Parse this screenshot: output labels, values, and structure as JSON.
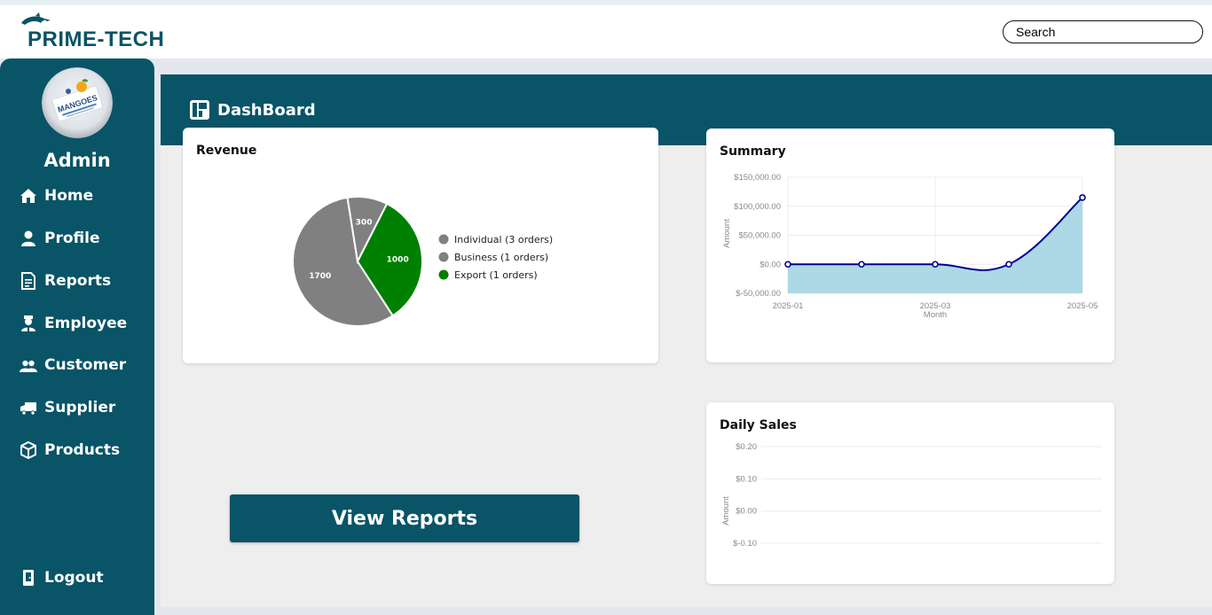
{
  "header": {
    "brand": "PRIME-TECH",
    "search_placeholder": "Search"
  },
  "sidebar": {
    "user_name": "Admin",
    "avatar_logo_text": "MANGOES",
    "items": [
      {
        "label": "Home",
        "icon": "home-icon"
      },
      {
        "label": "Profile",
        "icon": "user-icon"
      },
      {
        "label": "Reports",
        "icon": "report-icon"
      },
      {
        "label": "Employee",
        "icon": "employee-icon"
      },
      {
        "label": "Customer",
        "icon": "customers-icon"
      },
      {
        "label": "Supplier",
        "icon": "truck-icon"
      },
      {
        "label": "Products",
        "icon": "box-icon"
      }
    ],
    "logout": {
      "label": "Logout",
      "icon": "logout-icon"
    }
  },
  "dashboard": {
    "title": "DashBoard",
    "view_reports_label": "View Reports"
  },
  "colors": {
    "primary": "#095467",
    "pie_gray": "#808080",
    "pie_green": "#008000",
    "summary_line": "#00008b",
    "summary_fill": "#add8e6"
  },
  "chart_data": [
    {
      "type": "pie",
      "title": "Revenue",
      "slices": [
        {
          "label": "Individual (3 orders)",
          "value": 1700,
          "color": "#808080"
        },
        {
          "label": "Business (1 orders)",
          "value": 300,
          "color": "#808080"
        },
        {
          "label": "Export (1 orders)",
          "value": 1000,
          "color": "#008000"
        }
      ],
      "legend_position": "right"
    },
    {
      "type": "area",
      "title": "Summary",
      "xlabel": "Month",
      "ylabel": "Amount",
      "x": [
        "2025-01",
        "2025-02",
        "2025-03",
        "2025-04",
        "2025-05"
      ],
      "x_tick_labels": [
        "2025-01",
        "2025-03",
        "2025-05"
      ],
      "values": [
        0,
        0,
        0,
        0,
        115000
      ],
      "ylim": [
        -50000,
        150000
      ],
      "y_ticks": [
        "$150,000.00",
        "$100,000.00",
        "$50,000.00",
        "$0.00",
        "$-50,000.00"
      ],
      "grid": true
    },
    {
      "type": "line",
      "title": "Daily Sales",
      "ylabel": "Amount",
      "x": [],
      "values": [],
      "ylim": [
        -0.1,
        0.2
      ],
      "y_ticks": [
        "$0.20",
        "$0.10",
        "$0.00",
        "$-0.10"
      ],
      "grid": true
    }
  ]
}
